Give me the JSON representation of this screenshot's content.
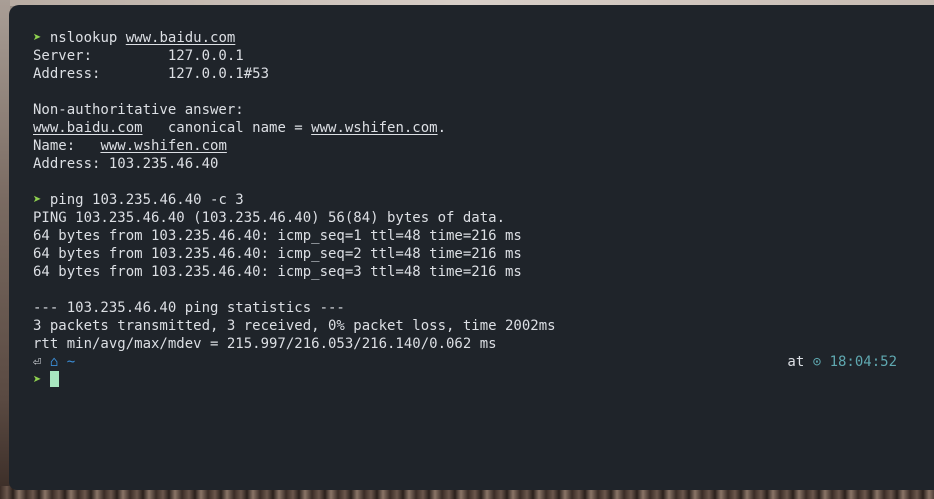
{
  "terminal": {
    "lines": {
      "l1_prompt": "➤",
      "l1_cmd": "nslookup",
      "l1_arg": "www.baidu.com",
      "l2": "Server:\t\t127.0.0.1",
      "l3": "Address:\t127.0.0.1#53",
      "l5": "Non-authoritative answer:",
      "l6_host": "www.baidu.com",
      "l6_mid": "   canonical name = ",
      "l6_target": "www.wshifen.com",
      "l6_end": ".",
      "l7_label": "Name:   ",
      "l7_host": "www.wshifen.com",
      "l8": "Address: 103.235.46.40",
      "l10_prompt": "➤",
      "l10_cmd": "ping",
      "l10_args": " 103.235.46.40 -c 3",
      "l11": "PING 103.235.46.40 (103.235.46.40) 56(84) bytes of data.",
      "l12": "64 bytes from 103.235.46.40: icmp_seq=1 ttl=48 time=216 ms",
      "l13": "64 bytes from 103.235.46.40: icmp_seq=2 ttl=48 time=216 ms",
      "l14": "64 bytes from 103.235.46.40: icmp_seq=3 ttl=48 time=216 ms",
      "l16": "--- 103.235.46.40 ping statistics ---",
      "l17": "3 packets transmitted, 3 received, 0% packet loss, time 2002ms",
      "l18": "rtt min/avg/max/mdev = 215.997/216.053/216.140/0.062 ms"
    },
    "status": {
      "return_icon": "⏎",
      "home_icon": "⌂",
      "dir": "~",
      "at_word": "at",
      "clock_icon": "⊙",
      "time": "18:04:52"
    },
    "input_prompt": "➤"
  },
  "colors": {
    "terminal_bg": "#1f242a",
    "prompt_green": "#8fd14f",
    "time_teal": "#5fa8b0",
    "dir_blue": "#3b8fd9",
    "cursor": "#a8e6c0"
  }
}
